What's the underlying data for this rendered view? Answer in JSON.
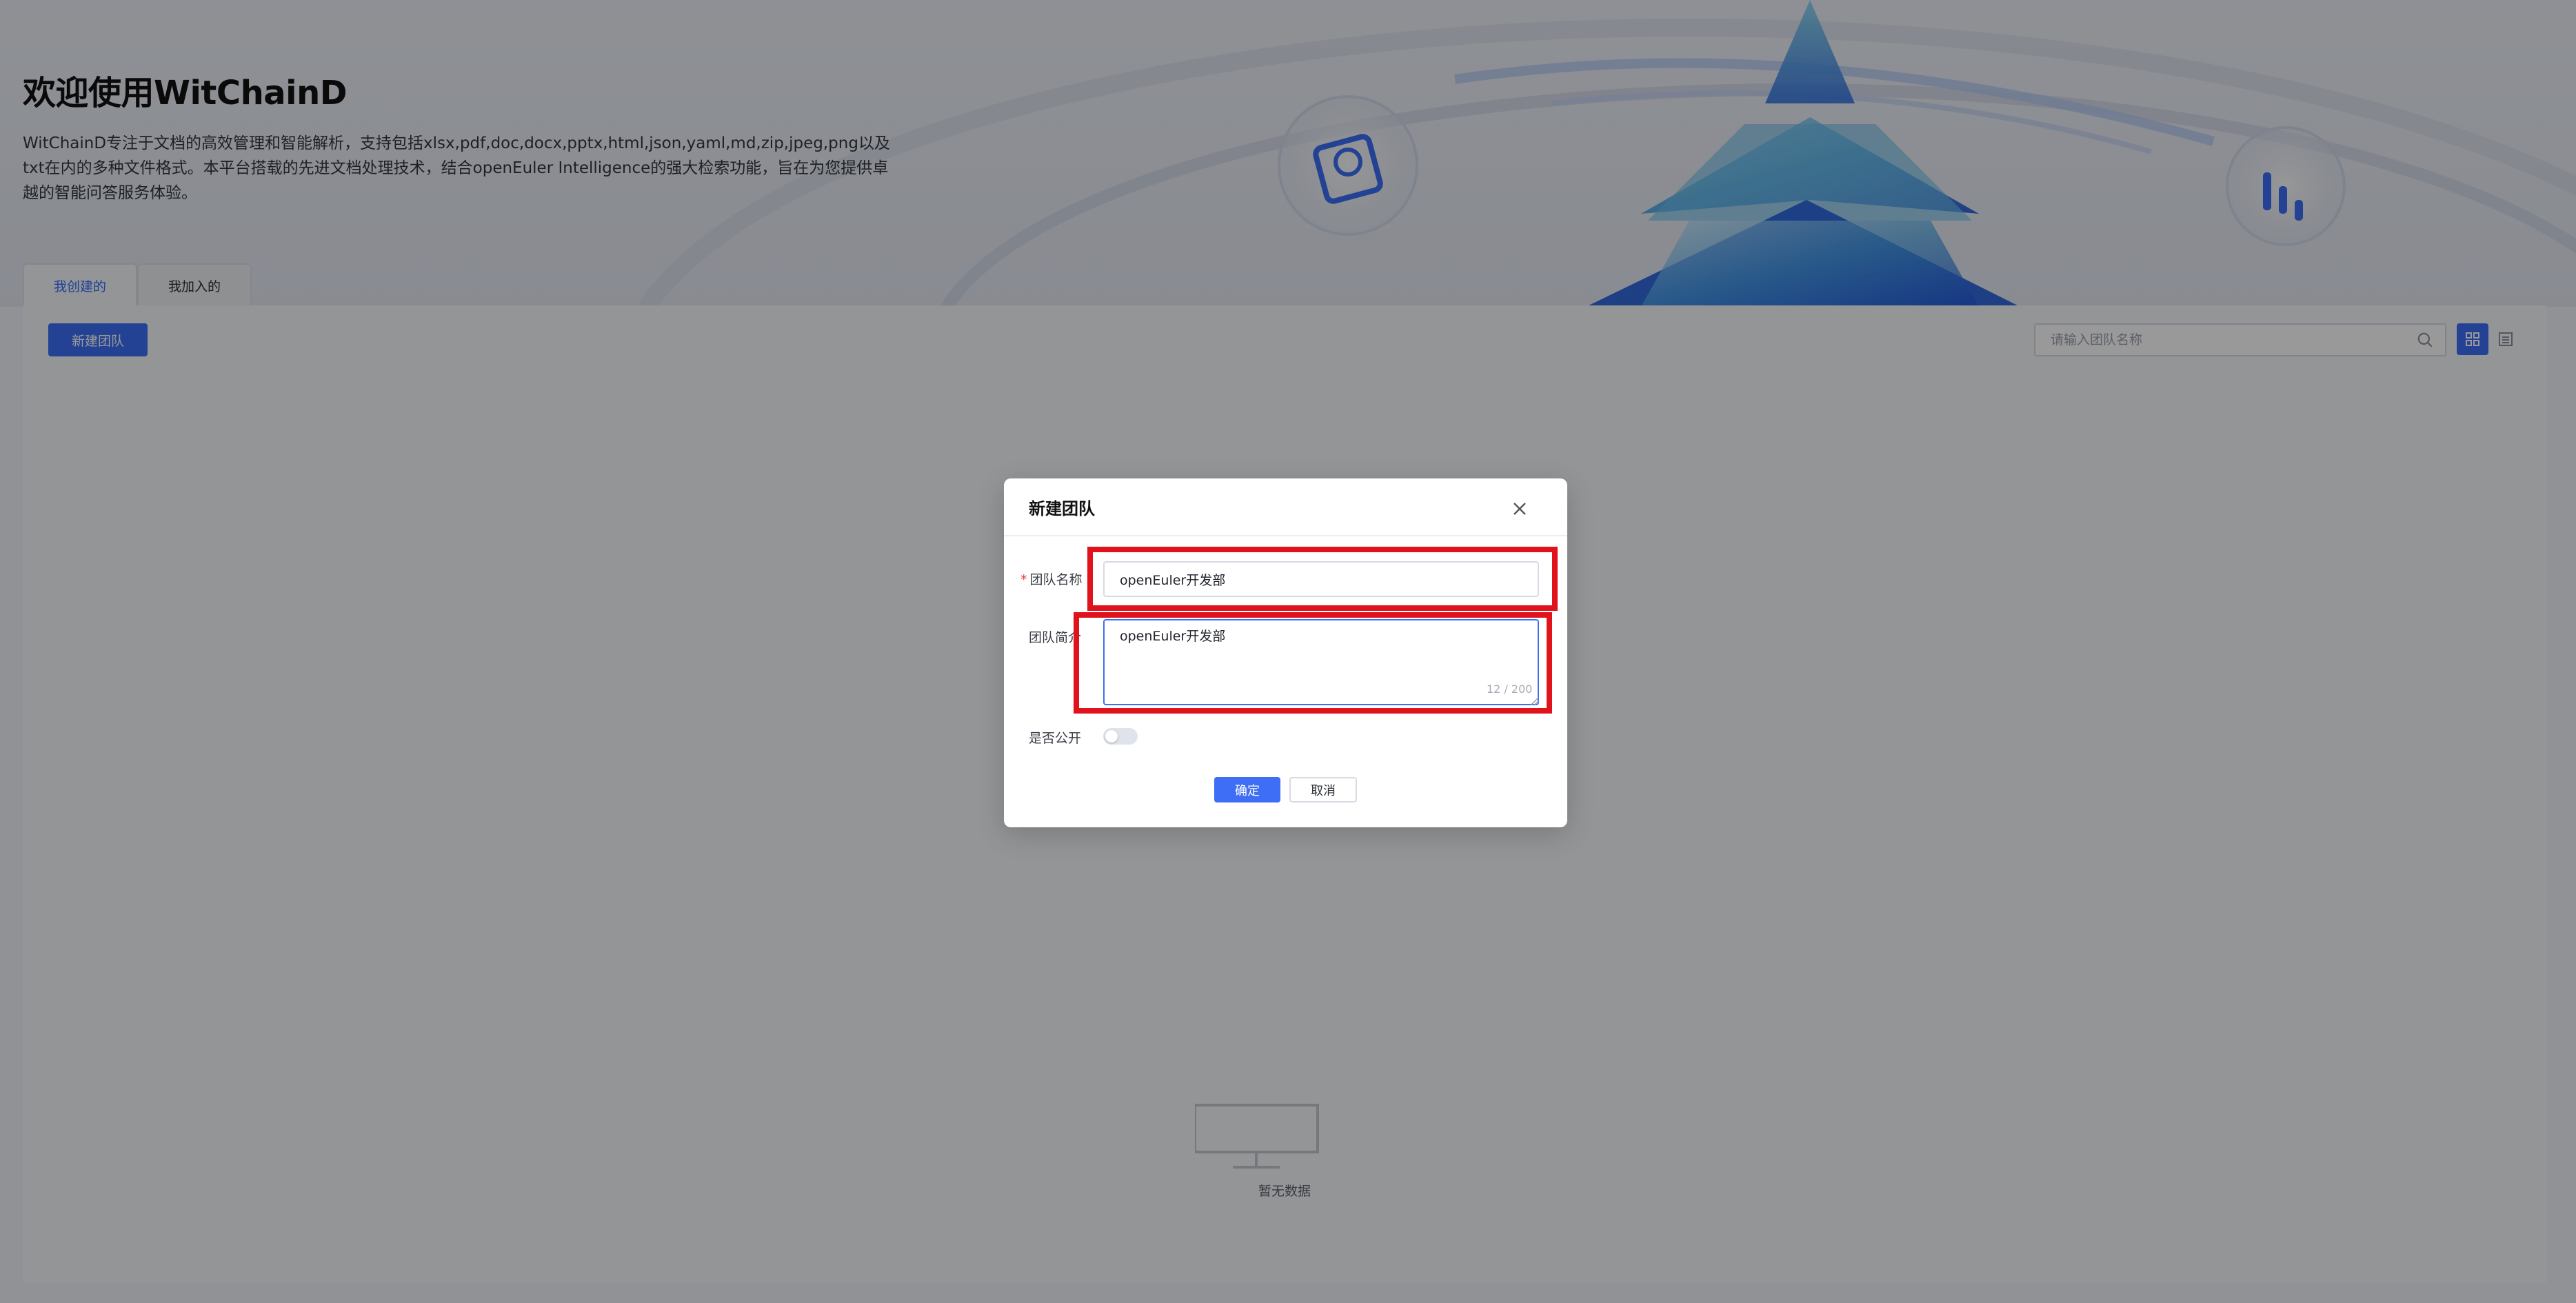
{
  "hero": {
    "title": "欢迎使用WitChainD",
    "description": "WitChainD专注于文档的高效管理和智能解析，支持包括xlsx,pdf,doc,docx,pptx,html,json,yaml,md,zip,jpeg,png以及txt在内的多种文件格式。本平台搭载的先进文档处理技术，结合openEuler Intelligence的强大检索功能，旨在为您提供卓越的智能问答服务体验。"
  },
  "tabs": [
    {
      "label": "我创建的",
      "active": true
    },
    {
      "label": "我加入的",
      "active": false
    }
  ],
  "toolbar": {
    "new_team_label": "新建团队",
    "search_placeholder": "请输入团队名称",
    "view_grid_icon": "grid-view-icon",
    "view_list_icon": "list-view-icon"
  },
  "empty_state": {
    "text": "暂无数据",
    "icon": "empty-monitor-icon"
  },
  "dialog": {
    "title": "新建团队",
    "close_icon": "close-icon",
    "fields": {
      "name_label": "团队名称",
      "name_required_mark": "*",
      "name_value": "openEuler开发部",
      "desc_label": "团队简介",
      "desc_value": "openEuler开发部",
      "desc_counter": "12 / 200",
      "public_label": "是否公开",
      "public_value": false
    },
    "confirm_label": "确定",
    "cancel_label": "取消"
  },
  "colors": {
    "primary": "#3d6ef5",
    "highlight": "#e0121b",
    "overlay": "rgba(0,0,0,0.40)"
  }
}
